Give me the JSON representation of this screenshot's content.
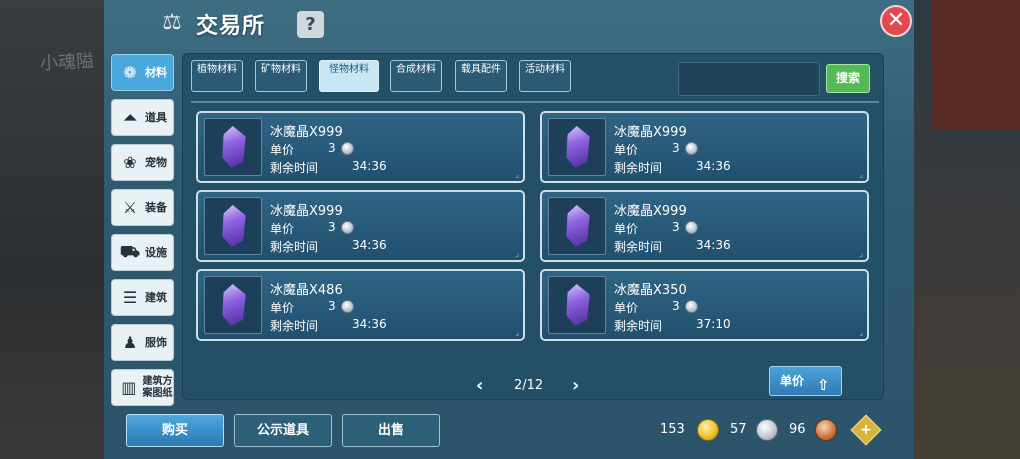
{
  "background": {
    "left_text": "小魂隘"
  },
  "header": {
    "title": "交易所",
    "help_label": "?",
    "close_label": "✕"
  },
  "sidebar": {
    "items": [
      {
        "label": "材料",
        "icon": "materials-icon",
        "glyph": "❁"
      },
      {
        "label": "道具",
        "icon": "potion-icon",
        "glyph": "⏶"
      },
      {
        "label": "宠物",
        "icon": "paw-icon",
        "glyph": "❀"
      },
      {
        "label": "装备",
        "icon": "sword-icon",
        "glyph": "⚔"
      },
      {
        "label": "设施",
        "icon": "facility-icon",
        "glyph": "⛟"
      },
      {
        "label": "建筑",
        "icon": "building-icon",
        "glyph": "☰"
      },
      {
        "label": "服饰",
        "icon": "clothing-icon",
        "glyph": "♟"
      },
      {
        "label": "建筑方案图纸",
        "icon": "blueprint-icon",
        "glyph": "▥"
      }
    ],
    "active_index": 0
  },
  "tabs": {
    "items": [
      "植物材料",
      "矿物材料",
      "怪物材料",
      "合成材料",
      "载具配件",
      "活动材料"
    ],
    "active_index": 2
  },
  "search": {
    "placeholder": "",
    "button_label": "搜索"
  },
  "listings": [
    {
      "name": "冰魔晶X999",
      "price_label": "单价",
      "price": "3",
      "time_label": "剩余时间",
      "time": "34:36"
    },
    {
      "name": "冰魔晶X999",
      "price_label": "单价",
      "price": "3",
      "time_label": "剩余时间",
      "time": "34:36"
    },
    {
      "name": "冰魔晶X999",
      "price_label": "单价",
      "price": "3",
      "time_label": "剩余时间",
      "time": "34:36"
    },
    {
      "name": "冰魔晶X999",
      "price_label": "单价",
      "price": "3",
      "time_label": "剩余时间",
      "time": "34:36"
    },
    {
      "name": "冰魔晶X486",
      "price_label": "单价",
      "price": "3",
      "time_label": "剩余时间",
      "time": "34:36"
    },
    {
      "name": "冰魔晶X350",
      "price_label": "单价",
      "price": "3",
      "time_label": "剩余时间",
      "time": "37:10"
    }
  ],
  "pager": {
    "prev": "‹",
    "label": "2/12",
    "next": "›"
  },
  "sort": {
    "label": "单价"
  },
  "bottom": {
    "buy_label": "购买",
    "public_label": "公示道具",
    "sell_label": "出售"
  },
  "currency": {
    "gold": "153",
    "silver": "57",
    "copper": "96"
  }
}
